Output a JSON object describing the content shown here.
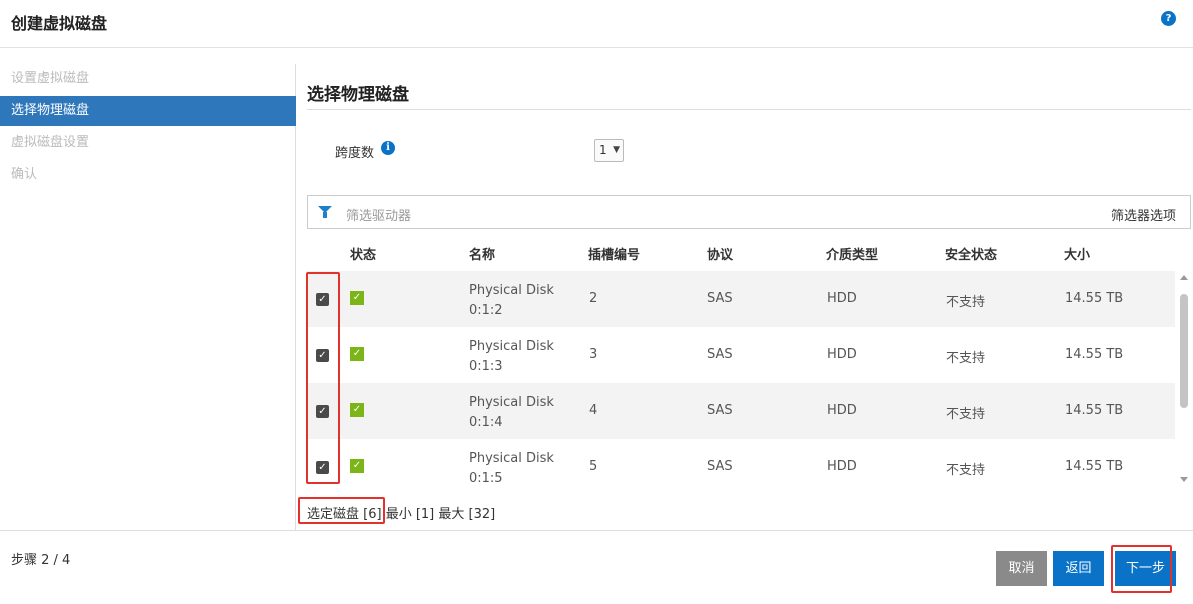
{
  "header": {
    "title": "创建虚拟磁盘",
    "help_icon": "?"
  },
  "sidebar": {
    "steps": [
      {
        "label": "设置虚拟磁盘",
        "active": false
      },
      {
        "label": "选择物理磁盘",
        "active": true
      },
      {
        "label": "虚拟磁盘设置",
        "active": false
      },
      {
        "label": "确认",
        "active": false
      }
    ]
  },
  "main": {
    "title": "选择物理磁盘",
    "span_label": "跨度数",
    "info_icon": "i",
    "span_value": "1",
    "filter": {
      "placeholder": "筛选驱动器",
      "options_label": "筛选器选项"
    },
    "columns": [
      "状态",
      "名称",
      "插槽编号",
      "协议",
      "介质类型",
      "安全状态",
      "大小"
    ],
    "rows": [
      {
        "checked": true,
        "status": "ok",
        "name_line1": "Physical Disk",
        "name_line2": "0:1:2",
        "slot": "2",
        "protocol": "SAS",
        "media": "HDD",
        "security": "不支持",
        "size": "14.55 TB"
      },
      {
        "checked": true,
        "status": "ok",
        "name_line1": "Physical Disk",
        "name_line2": "0:1:3",
        "slot": "3",
        "protocol": "SAS",
        "media": "HDD",
        "security": "不支持",
        "size": "14.55 TB"
      },
      {
        "checked": true,
        "status": "ok",
        "name_line1": "Physical Disk",
        "name_line2": "0:1:4",
        "slot": "4",
        "protocol": "SAS",
        "media": "HDD",
        "security": "不支持",
        "size": "14.55 TB"
      },
      {
        "checked": true,
        "status": "ok",
        "name_line1": "Physical Disk",
        "name_line2": "0:1:5",
        "slot": "5",
        "protocol": "SAS",
        "media": "HDD",
        "security": "不支持",
        "size": "14.55 TB"
      }
    ],
    "summary": {
      "selected": "选定磁盘 [6]",
      "min": "最小 [1]",
      "max": "最大 [32]"
    }
  },
  "footer": {
    "step_count": "步骤 2 / 4",
    "cancel_label": "取消",
    "back_label": "返回",
    "next_label": "下一步"
  },
  "colors": {
    "accent": "#0a73c7",
    "sidebar_active": "#2f77bb",
    "status_ok": "#7cb518",
    "highlight": "#e3322b",
    "cancel_button": "#8a8a8a"
  }
}
